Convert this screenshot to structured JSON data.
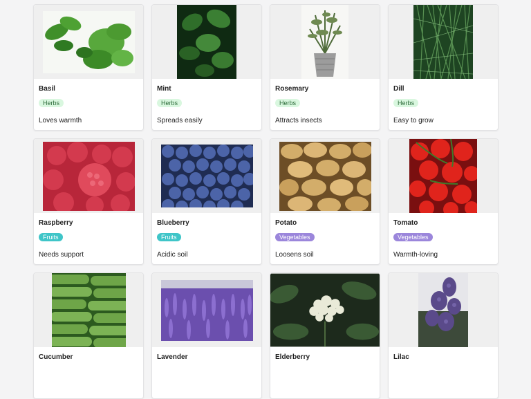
{
  "cards": [
    {
      "name": "Basil",
      "category": "Herbs",
      "category_key": "herbs",
      "note": "Loves warmth",
      "image": "basil-photo"
    },
    {
      "name": "Mint",
      "category": "Herbs",
      "category_key": "herbs",
      "note": "Spreads easily",
      "image": "mint-photo"
    },
    {
      "name": "Rosemary",
      "category": "Herbs",
      "category_key": "herbs",
      "note": "Attracts insects",
      "image": "rosemary-photo"
    },
    {
      "name": "Dill",
      "category": "Herbs",
      "category_key": "herbs",
      "note": "Easy to grow",
      "image": "dill-photo"
    },
    {
      "name": "Raspberry",
      "category": "Fruits",
      "category_key": "fruits",
      "note": "Needs support",
      "image": "raspberry-photo"
    },
    {
      "name": "Blueberry",
      "category": "Fruits",
      "category_key": "fruits",
      "note": "Acidic soil",
      "image": "blueberry-photo"
    },
    {
      "name": "Potato",
      "category": "Vegetables",
      "category_key": "vegetables",
      "note": "Loosens soil",
      "image": "potato-photo"
    },
    {
      "name": "Tomato",
      "category": "Vegetables",
      "category_key": "vegetables",
      "note": "Warmth-loving",
      "image": "tomato-photo"
    },
    {
      "name": "Cucumber",
      "category": "",
      "category_key": "",
      "note": "",
      "image": "cucumber-photo"
    },
    {
      "name": "Lavender",
      "category": "",
      "category_key": "",
      "note": "",
      "image": "lavender-photo"
    },
    {
      "name": "Elderberry",
      "category": "",
      "category_key": "",
      "note": "",
      "image": "elderberry-photo"
    },
    {
      "name": "Lilac",
      "category": "",
      "category_key": "",
      "note": "",
      "image": "lilac-photo"
    }
  ],
  "colors": {
    "herbs_badge": "#d9f7df",
    "fruits_badge": "#3fc5c8",
    "vegetables_badge": "#9b86db"
  }
}
